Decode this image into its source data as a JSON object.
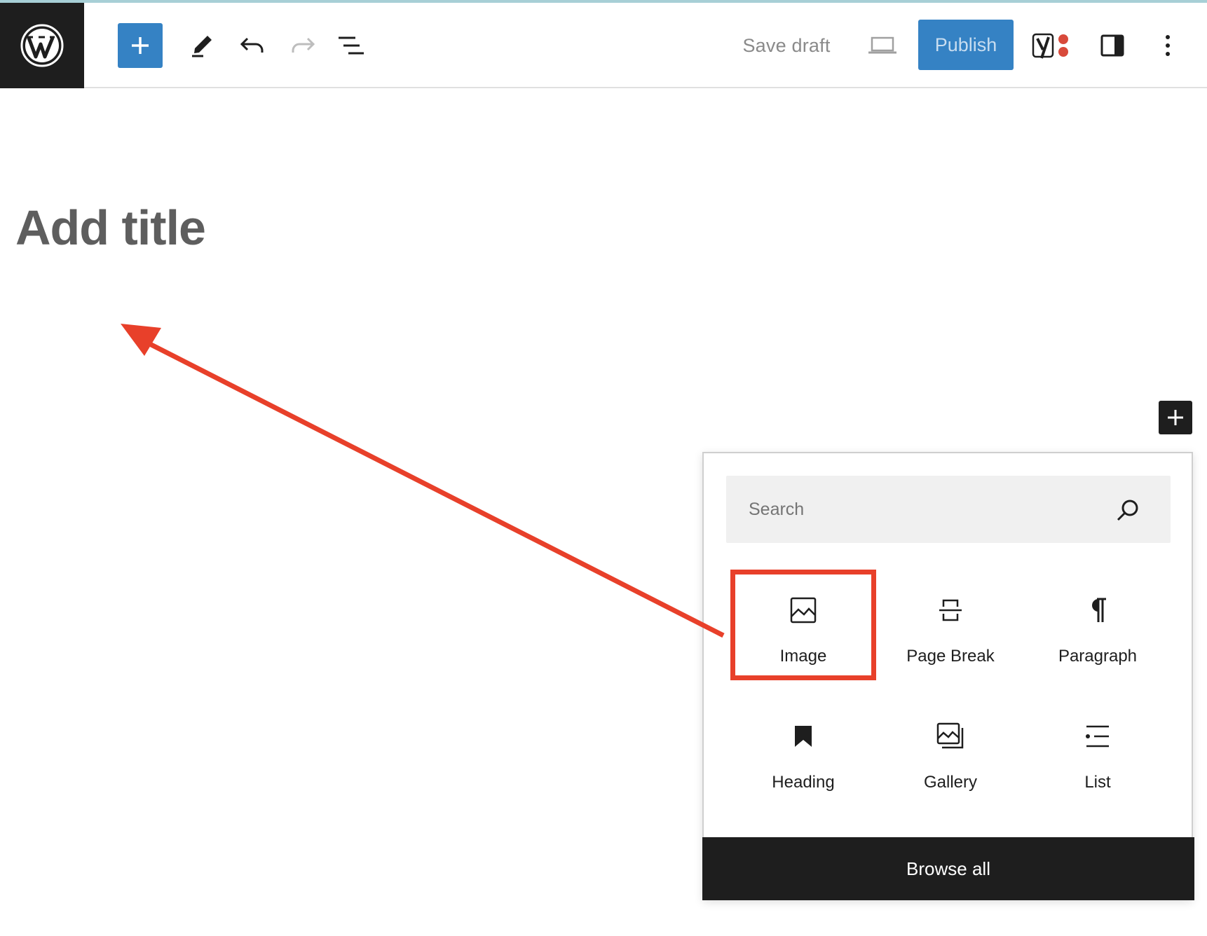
{
  "toolbar": {
    "save_draft": "Save draft",
    "publish": "Publish",
    "accent_color": "#3582c4"
  },
  "editor": {
    "title_placeholder": "Add title"
  },
  "inserter": {
    "search_placeholder": "Search",
    "blocks": [
      {
        "label": "Image",
        "icon": "image-icon"
      },
      {
        "label": "Page Break",
        "icon": "page-break-icon"
      },
      {
        "label": "Paragraph",
        "icon": "paragraph-icon"
      },
      {
        "label": "Heading",
        "icon": "bookmark-icon"
      },
      {
        "label": "Gallery",
        "icon": "gallery-icon"
      },
      {
        "label": "List",
        "icon": "list-icon"
      }
    ],
    "browse_all": "Browse all",
    "highlight_color": "#e8402a"
  }
}
